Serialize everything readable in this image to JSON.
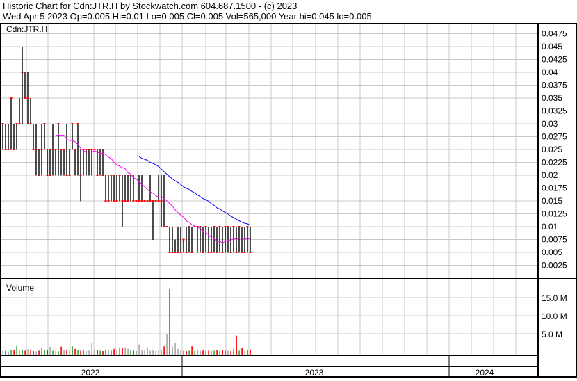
{
  "header": {
    "title": "Historic Chart for Cdn:JTR.H by Stockwatch.com 604.687.1500 - (c) 2023",
    "summary": "Wed Apr  5 2023  Op=0.005  Hi=0.01  Lo=0.005  Cl=0.005  Vol=565,000  Year hi=0.045  lo=0.005"
  },
  "colors": {
    "up": "#33aa33",
    "down": "#ff0000",
    "flat": "#aaaaaa",
    "ma_short": "#ff00ff",
    "ma_long": "#0000ff",
    "grid": "#c8c8c8"
  },
  "chart_data": [
    {
      "type": "ohlc",
      "title": "Cdn:JTR.H",
      "ylim": [
        0,
        0.0493
      ],
      "y_ticks": [
        "0.0475",
        "0.045",
        "0.0425",
        "0.04",
        "0.0375",
        "0.035",
        "0.0325",
        "0.03",
        "0.0275",
        "0.025",
        "0.0225",
        "0.02",
        "0.0175",
        "0.015",
        "0.0125",
        "0.01",
        "0.0075",
        "0.005",
        "0.0025"
      ],
      "moving_averages": [
        {
          "period": 20,
          "color": "#ff00ff"
        },
        {
          "period": 50,
          "color": "#0000ff"
        }
      ],
      "bars_hlc": [
        [
          0.03,
          0.025,
          0.03
        ],
        [
          0.03,
          0.025,
          0.025
        ],
        [
          0.03,
          0.025,
          0.025
        ],
        [
          0.035,
          0.025,
          0.035
        ],
        [
          0.03,
          0.025,
          0.025
        ],
        [
          0.03,
          0.025,
          0.03
        ],
        [
          0.035,
          0.03,
          0.03
        ],
        [
          0.045,
          0.03,
          0.04
        ],
        [
          0.04,
          0.035,
          0.035
        ],
        [
          0.04,
          0.03,
          0.035
        ],
        [
          0.035,
          0.03,
          0.03
        ],
        [
          0.03,
          0.025,
          0.025
        ],
        [
          0.03,
          0.02,
          0.025
        ],
        [
          0.025,
          0.02,
          0.02
        ],
        [
          0.03,
          0.02,
          0.025
        ],
        [
          0.03,
          0.025,
          0.03
        ],
        [
          0.025,
          0.02,
          0.02
        ],
        [
          0.025,
          0.02,
          0.02
        ],
        [
          0.03,
          0.02,
          0.025
        ],
        [
          0.025,
          0.02,
          0.025
        ],
        [
          0.03,
          0.02,
          0.03
        ],
        [
          0.025,
          0.02,
          0.025
        ],
        [
          0.025,
          0.02,
          0.025
        ],
        [
          0.03,
          0.02,
          0.02
        ],
        [
          0.025,
          0.02,
          0.02
        ],
        [
          0.03,
          0.025,
          0.03
        ],
        [
          0.025,
          0.02,
          0.025
        ],
        [
          0.03,
          0.02,
          0.03
        ],
        [
          0.025,
          0.015,
          0.02
        ],
        [
          0.025,
          0.02,
          0.025
        ],
        [
          0.025,
          0.02,
          0.025
        ],
        [
          0.025,
          0.02,
          0.025
        ],
        [
          0.025,
          0.02,
          0.025
        ],
        [
          0.025,
          0.025,
          0.025
        ],
        [
          0.025,
          0.02,
          0.02
        ],
        [
          0.025,
          0.02,
          0.025
        ],
        [
          0.025,
          0.02,
          0.02
        ],
        [
          0.02,
          0.015,
          0.015
        ],
        [
          0.02,
          0.015,
          0.015
        ],
        [
          0.02,
          0.015,
          0.02
        ],
        [
          0.02,
          0.015,
          0.015
        ],
        [
          0.02,
          0.015,
          0.015
        ],
        [
          0.02,
          0.015,
          0.02
        ],
        [
          0.02,
          0.01,
          0.015
        ],
        [
          0.02,
          0.015,
          0.015
        ],
        [
          0.02,
          0.015,
          0.015
        ],
        [
          0.02,
          0.015,
          0.02
        ],
        [
          0.02,
          0.015,
          0.015
        ],
        [
          0.015,
          0.015,
          0.015
        ],
        [
          0.02,
          0.015,
          0.015
        ],
        [
          0.02,
          0.015,
          0.015
        ],
        [
          0.015,
          0.015,
          0.015
        ],
        [
          0.015,
          0.015,
          0.015
        ],
        [
          0.02,
          0.015,
          0.015
        ],
        [
          0.015,
          0.0075,
          0.015
        ],
        [
          0.015,
          0.015,
          0.015
        ],
        [
          0.02,
          0.015,
          0.015
        ],
        [
          0.02,
          0.01,
          0.015
        ],
        [
          0.02,
          0.01,
          0.01
        ],
        [
          0.01,
          0.01,
          0.01
        ],
        [
          0.01,
          0.005,
          0.005
        ],
        [
          0.01,
          0.005,
          0.005
        ],
        [
          0.0075,
          0.005,
          0.005
        ],
        [
          0.01,
          0.005,
          0.005
        ],
        [
          0.01,
          0.005,
          0.005
        ],
        [
          0.0075,
          0.005,
          0.0075
        ],
        [
          0.01,
          0.005,
          0.005
        ],
        [
          0.01,
          0.005,
          0.01
        ],
        [
          0.01,
          0.005,
          0.005
        ],
        [
          0.01,
          0.01,
          0.01
        ],
        [
          0.01,
          0.005,
          0.01
        ],
        [
          0.01,
          0.005,
          0.01
        ],
        [
          0.01,
          0.005,
          0.005
        ],
        [
          0.01,
          0.005,
          0.01
        ],
        [
          0.01,
          0.005,
          0.005
        ],
        [
          0.01,
          0.005,
          0.005
        ],
        [
          0.01,
          0.005,
          0.01
        ],
        [
          0.01,
          0.005,
          0.005
        ],
        [
          0.01,
          0.005,
          0.01
        ],
        [
          0.01,
          0.005,
          0.005
        ],
        [
          0.01,
          0.005,
          0.01
        ],
        [
          0.01,
          0.005,
          0.01
        ],
        [
          0.01,
          0.005,
          0.005
        ],
        [
          0.01,
          0.005,
          0.01
        ],
        [
          0.01,
          0.005,
          0.005
        ],
        [
          0.01,
          0.005,
          0.01
        ],
        [
          0.01,
          0.005,
          0.005
        ],
        [
          0.01,
          0.005,
          0.005
        ],
        [
          0.01,
          0.005,
          0.01
        ],
        [
          0.01,
          0.005,
          0.005
        ]
      ]
    },
    {
      "type": "bar",
      "title": "Volume",
      "unit": "M",
      "ylim": [
        0,
        19
      ],
      "y_ticks": [
        "15.0 M",
        "10.0 M",
        "5.0 M"
      ],
      "values": [
        0.2,
        0.3,
        0.1,
        0.4,
        0.5,
        1.8,
        0.3,
        0.6,
        0.3,
        0.7,
        0.4,
        0.2,
        0.1,
        0.3,
        1.0,
        0.4,
        0.6,
        1.4,
        0.3,
        0.2,
        0.1,
        1.4,
        0.6,
        0.4,
        0.3,
        1.5,
        0.8,
        0.5,
        0.3,
        0.6,
        0.2,
        0.3,
        2.5,
        0.4,
        0.6,
        0.3,
        0.2,
        0.4,
        0.5,
        0.3,
        0.8,
        0.4,
        1.2,
        1.0,
        1.2,
        0.8,
        0.5,
        0.3,
        0.2,
        2.0,
        0.4,
        0.6,
        1.2,
        0.3,
        0.5,
        0.2,
        0.3,
        0.6,
        1.5,
        4.8,
        17.5,
        1.5,
        2.4,
        0.8,
        0.4,
        0.3,
        0.2,
        0.3,
        1.5,
        0.2,
        0.4,
        0.3,
        0.5,
        0.2,
        0.3,
        0.2,
        0.3,
        0.4,
        0.2,
        0.5,
        0.3,
        0.3,
        0.2,
        0.8,
        4.5,
        0.3,
        1.0,
        0.2,
        0.5,
        0.4
      ]
    }
  ],
  "time_axis": {
    "years": [
      "2022",
      "2023",
      "2024"
    ]
  }
}
